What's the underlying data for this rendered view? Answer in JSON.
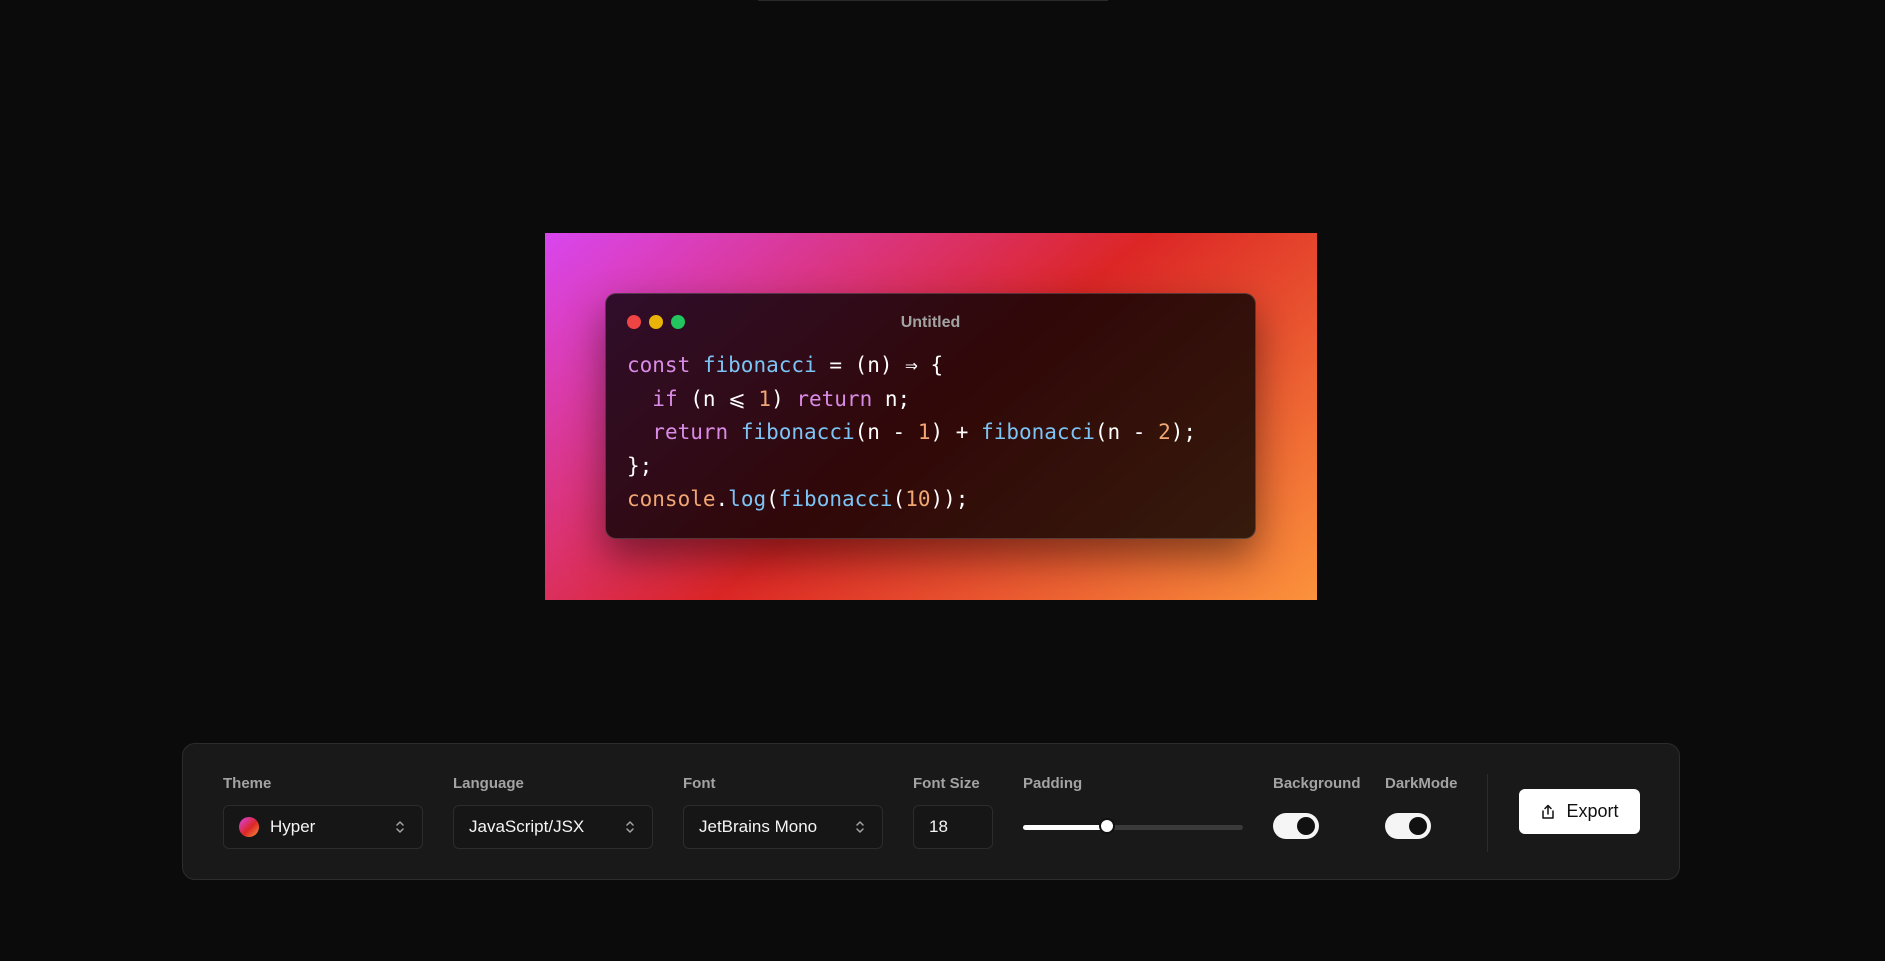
{
  "preview": {
    "window_title": "Untitled",
    "background_gradient": [
      "#d946ef",
      "#dc2626",
      "#fb923c"
    ],
    "traffic_lights": [
      "#ef4444",
      "#eab308",
      "#22c55e"
    ],
    "code_lines": [
      [
        {
          "t": "const",
          "c": "#d98be6"
        },
        {
          "t": " ",
          "c": "#ffffff"
        },
        {
          "t": "fibonacci",
          "c": "#7cc4f5"
        },
        {
          "t": " = (n) ⇒ {",
          "c": "#ffffff"
        }
      ],
      [
        {
          "t": "  ",
          "c": "#ffffff"
        },
        {
          "t": "if",
          "c": "#d98be6"
        },
        {
          "t": " (n ⩽ ",
          "c": "#ffffff"
        },
        {
          "t": "1",
          "c": "#f0a773"
        },
        {
          "t": ") ",
          "c": "#ffffff"
        },
        {
          "t": "return",
          "c": "#d98be6"
        },
        {
          "t": " n;",
          "c": "#ffffff"
        }
      ],
      [
        {
          "t": "  ",
          "c": "#ffffff"
        },
        {
          "t": "return",
          "c": "#d98be6"
        },
        {
          "t": " ",
          "c": "#ffffff"
        },
        {
          "t": "fibonacci",
          "c": "#7cc4f5"
        },
        {
          "t": "(n - ",
          "c": "#ffffff"
        },
        {
          "t": "1",
          "c": "#f0a773"
        },
        {
          "t": ") + ",
          "c": "#ffffff"
        },
        {
          "t": "fibonacci",
          "c": "#7cc4f5"
        },
        {
          "t": "(n - ",
          "c": "#ffffff"
        },
        {
          "t": "2",
          "c": "#f0a773"
        },
        {
          "t": ");",
          "c": "#ffffff"
        }
      ],
      [
        {
          "t": "};",
          "c": "#ffffff"
        }
      ],
      [
        {
          "t": "console",
          "c": "#f0a773"
        },
        {
          "t": ".",
          "c": "#ffffff"
        },
        {
          "t": "log",
          "c": "#7cc4f5"
        },
        {
          "t": "(",
          "c": "#ffffff"
        },
        {
          "t": "fibonacci",
          "c": "#7cc4f5"
        },
        {
          "t": "(",
          "c": "#ffffff"
        },
        {
          "t": "10",
          "c": "#f0a773"
        },
        {
          "t": "));",
          "c": "#ffffff"
        }
      ]
    ]
  },
  "toolbar": {
    "theme": {
      "label": "Theme",
      "value": "Hyper",
      "icon": "gradient-swatch-icon"
    },
    "language": {
      "label": "Language",
      "value": "JavaScript/JSX",
      "icon": "chevron-up-down-icon"
    },
    "font": {
      "label": "Font",
      "value": "JetBrains Mono",
      "icon": "chevron-up-down-icon"
    },
    "font_size": {
      "label": "Font Size",
      "value": "18"
    },
    "padding": {
      "label": "Padding",
      "value_fraction": 0.38
    },
    "background": {
      "label": "Background",
      "on": true
    },
    "dark_mode": {
      "label": "DarkMode",
      "on": true
    },
    "export": {
      "label": "Export",
      "icon": "share-icon"
    }
  }
}
